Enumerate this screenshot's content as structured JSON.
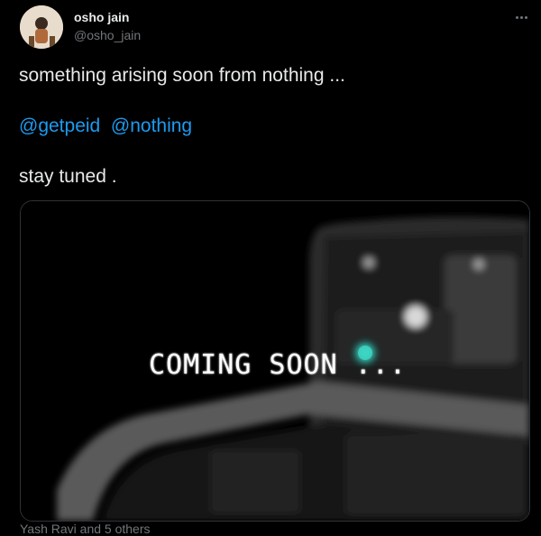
{
  "author": {
    "display_name": "osho jain",
    "handle": "@osho_jain",
    "avatar_icon": "user-avatar"
  },
  "more_icon": "more-horizontal-icon",
  "tweet": {
    "line1": "something arising soon from nothing ...",
    "mention1": "@getpeid",
    "mention2": "@nothing",
    "line3": "stay tuned ."
  },
  "media": {
    "overlay_text": "COMING SOON ..."
  },
  "footer": {
    "partial_text": "Yash Ravi and 5 others"
  },
  "colors": {
    "background": "#000000",
    "text": "#e7e9ea",
    "secondary": "#71767b",
    "link": "#1d9bf0",
    "accent_teal": "#3ad6c4"
  }
}
